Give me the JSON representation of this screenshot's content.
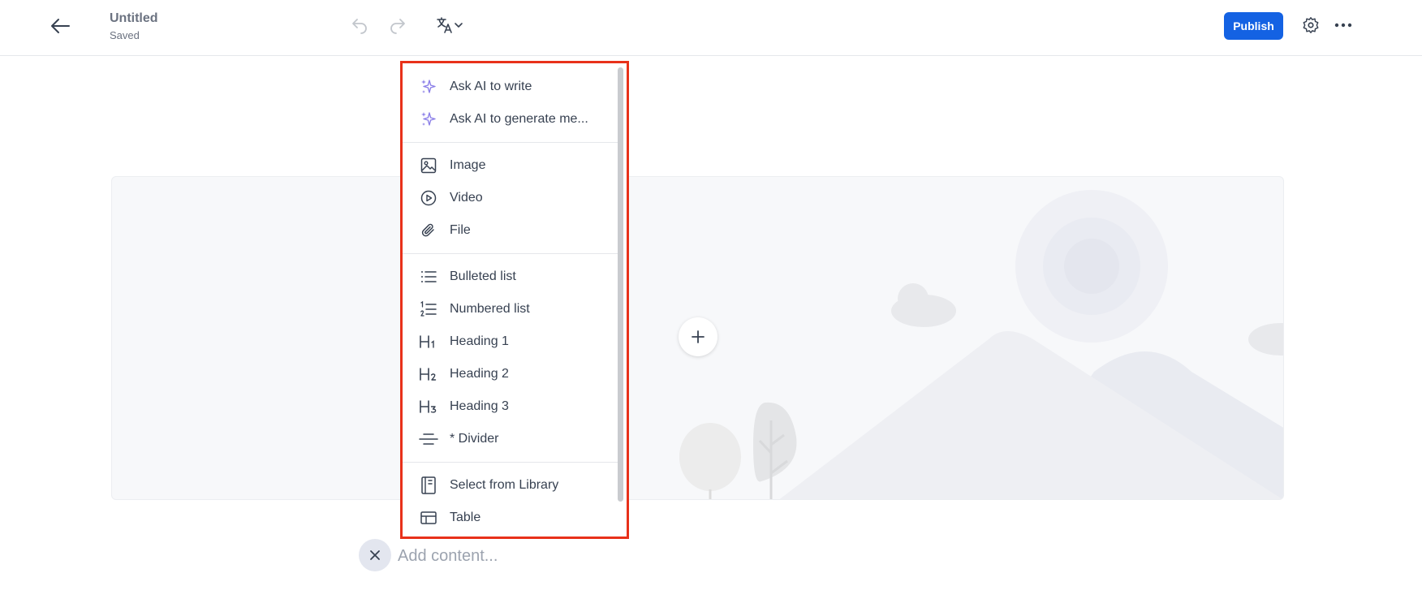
{
  "header": {
    "title": "Untitled",
    "status": "Saved",
    "publish_label": "Publish",
    "icons": [
      "back-arrow-icon",
      "undo-icon",
      "redo-icon",
      "translate-icon",
      "settings-icon",
      "more-icon"
    ]
  },
  "insert_menu": {
    "groups": [
      [
        {
          "label": "Ask AI to write",
          "icon": "sparkle-icon"
        },
        {
          "label": "Ask AI to generate me...",
          "icon": "sparkle-icon"
        }
      ],
      [
        {
          "label": "Image",
          "icon": "image-icon"
        },
        {
          "label": "Video",
          "icon": "video-icon"
        },
        {
          "label": "File",
          "icon": "paperclip-icon"
        }
      ],
      [
        {
          "label": "Bulleted list",
          "icon": "bulleted-list-icon"
        },
        {
          "label": "Numbered list",
          "icon": "numbered-list-icon"
        },
        {
          "label": "Heading 1",
          "icon": "heading-1-icon"
        },
        {
          "label": "Heading 2",
          "icon": "heading-2-icon"
        },
        {
          "label": "Heading 3",
          "icon": "heading-3-icon"
        },
        {
          "label": "* Divider",
          "icon": "divider-icon"
        }
      ],
      [
        {
          "label": "Select from Library",
          "icon": "library-icon"
        },
        {
          "label": "Table",
          "icon": "table-icon"
        }
      ]
    ]
  },
  "editor": {
    "placeholder": "Add content...",
    "icons": [
      "plus-icon",
      "close-icon"
    ]
  },
  "colors": {
    "accent": "#1462e3",
    "highlight_border": "#e8311a",
    "ai_icon": "#8b7fe8"
  }
}
